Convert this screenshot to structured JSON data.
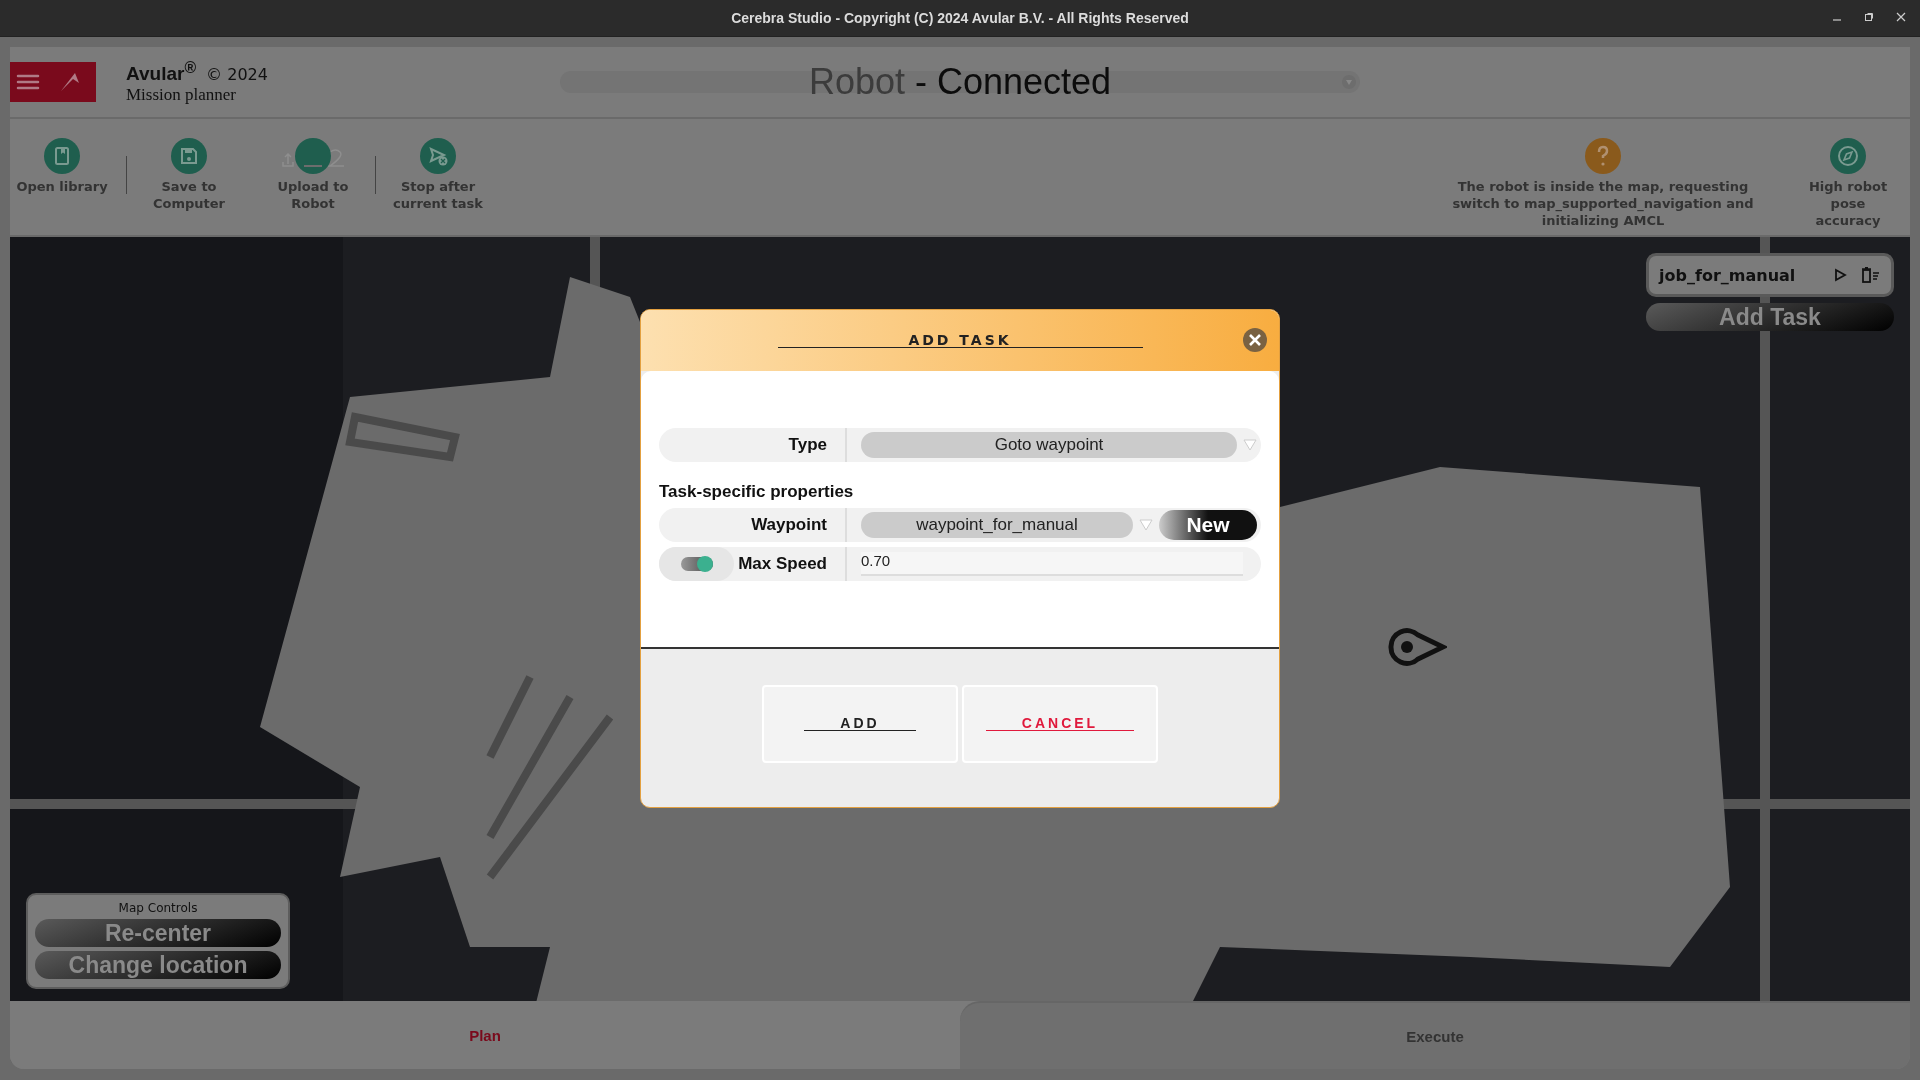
{
  "window": {
    "title": "Cerebra Studio - Copyright (C) 2024 Avular B.V. - All Rights Reserved"
  },
  "header": {
    "brand": "Avular$^{®}$",
    "copyright": "© 2024",
    "subtitle": "Mission planner",
    "device": "Robot",
    "status": "- Connected"
  },
  "toolbar": {
    "actions": [
      {
        "kind": "library",
        "label": "Open library"
      },
      {
        "kind": "save",
        "label": "Save to Computer"
      },
      {
        "kind": "upload",
        "label": "Upload to Robot"
      },
      {
        "kind": "stop",
        "label": "Stop after current task"
      }
    ],
    "statuses": [
      {
        "kind": "question",
        "color": "#8a5a1c",
        "label": "The robot is inside the map, requesting switch to map_supported_navigation and initializing AMCL"
      },
      {
        "kind": "compass",
        "color": "#1f5e4e",
        "label": "High robot pose accuracy"
      }
    ]
  },
  "job": {
    "name": "job_for_manual",
    "add_button": "Add Task"
  },
  "map_controls": {
    "title": "Map Controls",
    "buttons": [
      "Re-center",
      "Change location"
    ]
  },
  "dialog": {
    "title": "ADD TASK",
    "type_label": "Type",
    "type_value": "Goto waypoint",
    "section": "Task-specific properties",
    "properties": [
      {
        "kind": "select",
        "label": "Waypoint",
        "value": "waypoint_for_manual",
        "button": "New"
      },
      {
        "kind": "number",
        "label": "Max Speed",
        "on": true,
        "value": "0.70"
      }
    ],
    "buttons": [
      {
        "kind": "confirm",
        "label": "ADD"
      },
      {
        "kind": "cancel",
        "label": "CANCEL"
      }
    ]
  },
  "tabs": [
    {
      "label": "Plan",
      "selected": true
    },
    {
      "label": "Execute",
      "selected": false
    }
  ]
}
